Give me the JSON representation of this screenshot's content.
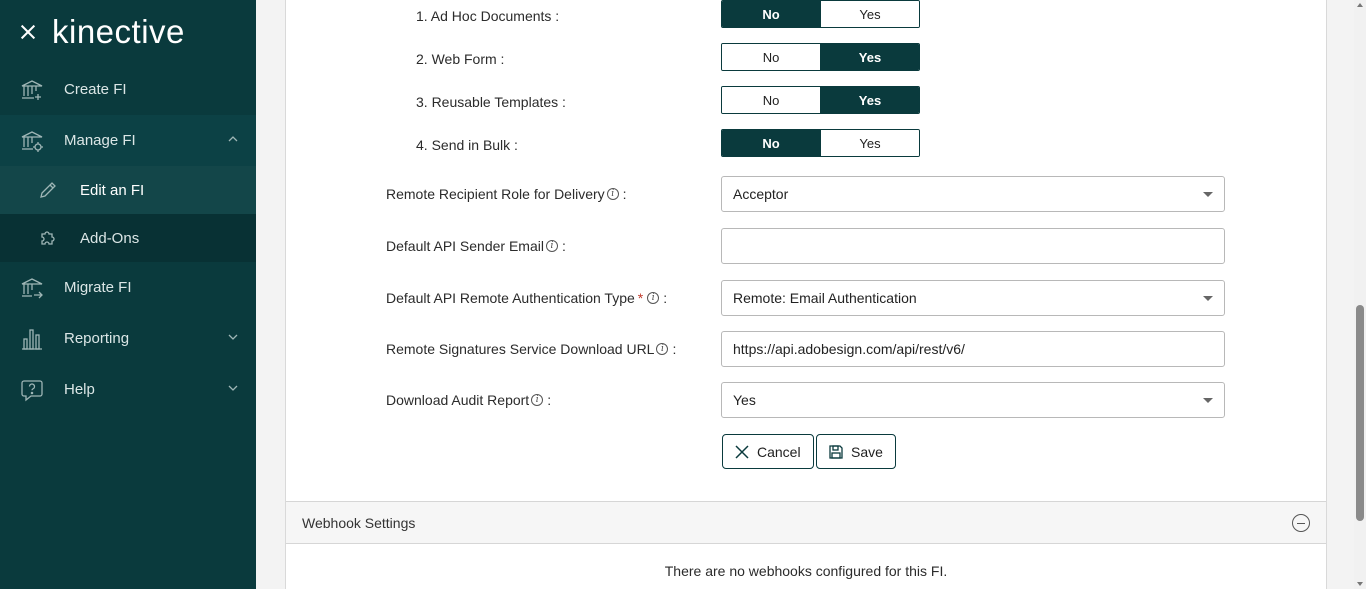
{
  "sidebar": {
    "logo": "kinective",
    "items": [
      {
        "label": "Create FI",
        "icon": "bank-plus-icon"
      },
      {
        "label": "Manage FI",
        "icon": "bank-gear-icon"
      },
      {
        "label": "Edit an FI",
        "icon": "pencil-icon"
      },
      {
        "label": "Add-Ons",
        "icon": "puzzle-icon"
      },
      {
        "label": "Migrate FI",
        "icon": "bank-arrow-icon"
      },
      {
        "label": "Reporting",
        "icon": "bar-chart-icon"
      },
      {
        "label": "Help",
        "icon": "question-bubble-icon"
      }
    ]
  },
  "features": [
    {
      "label": "1. Ad Hoc Documents :",
      "no": "No",
      "yes": "Yes",
      "selected": "No"
    },
    {
      "label": "2. Web Form :",
      "no": "No",
      "yes": "Yes",
      "selected": "Yes"
    },
    {
      "label": "3. Reusable Templates :",
      "no": "No",
      "yes": "Yes",
      "selected": "Yes"
    },
    {
      "label": "4. Send in Bulk :",
      "no": "No",
      "yes": "Yes",
      "selected": "No"
    }
  ],
  "fields": {
    "recipient_role": {
      "label": "Remote Recipient Role for Delivery",
      "value": "Acceptor"
    },
    "sender_email": {
      "label": "Default API Sender Email",
      "value": ""
    },
    "auth_type": {
      "label": "Default API Remote Authentication Type",
      "required_mark": "*",
      "value": "Remote: Email Authentication"
    },
    "download_url": {
      "label": "Remote Signatures Service Download URL",
      "value": "https://api.adobesign.com/api/rest/v6/"
    },
    "audit_report": {
      "label": "Download Audit Report",
      "value": "Yes"
    }
  },
  "colon": ":",
  "info_glyph": "i",
  "buttons": {
    "cancel": "Cancel",
    "save": "Save"
  },
  "webhook": {
    "title": "Webhook Settings",
    "empty": "There are no webhooks configured for this FI."
  },
  "colors": {
    "primary": "#0a3a3d",
    "sidebar_active": "#134649",
    "required": "#c0392b"
  }
}
